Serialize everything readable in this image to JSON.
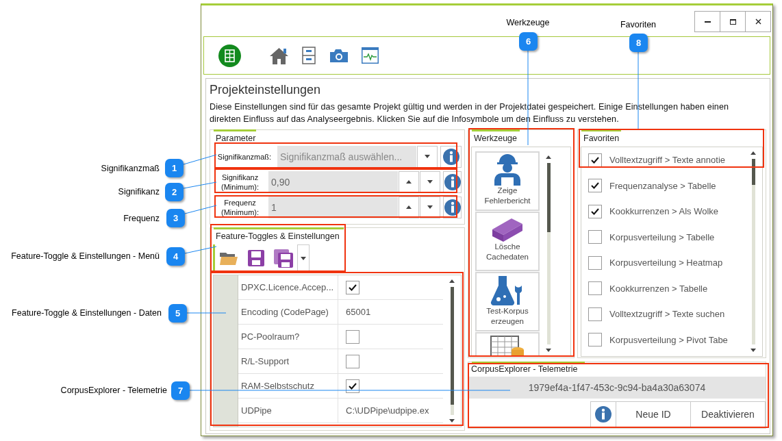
{
  "callouts": [
    {
      "number": "1",
      "label": "Signifikanzmaß"
    },
    {
      "number": "2",
      "label": "Signifikanz"
    },
    {
      "number": "3",
      "label": "Frequenz"
    },
    {
      "number": "4",
      "label": "Feature-Toggle & Einstellungen - Menü"
    },
    {
      "number": "5",
      "label": "Feature-Toggle & Einstellungen - Daten"
    },
    {
      "number": "6",
      "label": "Werkzeuge"
    },
    {
      "number": "7",
      "label": "CorpusExplorer - Telemetrie"
    },
    {
      "number": "8",
      "label": "Favoriten"
    }
  ],
  "page": {
    "title": "Projekteinstellungen",
    "description": "Diese Einstellungen sind für das gesamte Projekt gültig und werden in der Projektdatei gespeichert. Einige Einstellungen haben einen direkten Einfluss auf das Analyseergebnis. Klicken Sie auf die Infosymbole um den Einfluss zu verstehen."
  },
  "parameter": {
    "title": "Parameter",
    "rows": [
      {
        "kind": "select",
        "label": "Signifikanzmaß:",
        "placeholder": "Signifikanzmaß auswählen..."
      },
      {
        "kind": "spinner",
        "label": "Signifikanz (Minimum):",
        "value": "0,90"
      },
      {
        "kind": "spinner",
        "label": "Frequenz (Minimum):",
        "value": "1"
      }
    ]
  },
  "features": {
    "title": "Feature-Toggles & Einstellungen",
    "rows": [
      {
        "kind": "check",
        "name": "DPXC.Licence.Accep...",
        "checked": true
      },
      {
        "kind": "text",
        "name": "Encoding (CodePage)",
        "value": "65001"
      },
      {
        "kind": "check",
        "name": "PC-Poolraum?",
        "checked": false
      },
      {
        "kind": "check",
        "name": "R/L-Support",
        "checked": false
      },
      {
        "kind": "check",
        "name": "RAM-Selbstschutz",
        "checked": true
      },
      {
        "kind": "text",
        "name": "UDPipe",
        "value": "C:\\UDPipe\\udpipe.ex"
      }
    ]
  },
  "tools": {
    "title": "Werkzeuge",
    "items": [
      {
        "kind": "worker",
        "label": "Zeige Fehlerbericht"
      },
      {
        "kind": "blocks",
        "label": "Lösche Cachedaten"
      },
      {
        "kind": "flask",
        "label": "Test-Korpus erzeugen"
      },
      {
        "kind": "table"
      }
    ]
  },
  "favorites": {
    "title": "Favoriten",
    "items": [
      {
        "label": "Volltextzugriff > Texte annotie",
        "checked": true
      },
      {
        "label": "Frequenzanalyse > Tabelle",
        "checked": true
      },
      {
        "label": "Kookkurrenzen > Als Wolke",
        "checked": true
      },
      {
        "label": "Korpusverteilung > Tabelle",
        "checked": false
      },
      {
        "label": "Korpusverteilung > Heatmap",
        "checked": false
      },
      {
        "label": "Kookkurrenzen > Tabelle",
        "checked": false
      },
      {
        "label": "Volltextzugriff > Texte suchen",
        "checked": false
      },
      {
        "label": "Korpusverteilung > Pivot Tabe",
        "checked": false
      }
    ]
  },
  "telemetry": {
    "title": "CorpusExplorer - Telemetrie",
    "id": "1979ef4a-1f47-453c-9c94-ba4a30a63074",
    "buttons": [
      "Neue ID",
      "Deaktivieren"
    ]
  }
}
